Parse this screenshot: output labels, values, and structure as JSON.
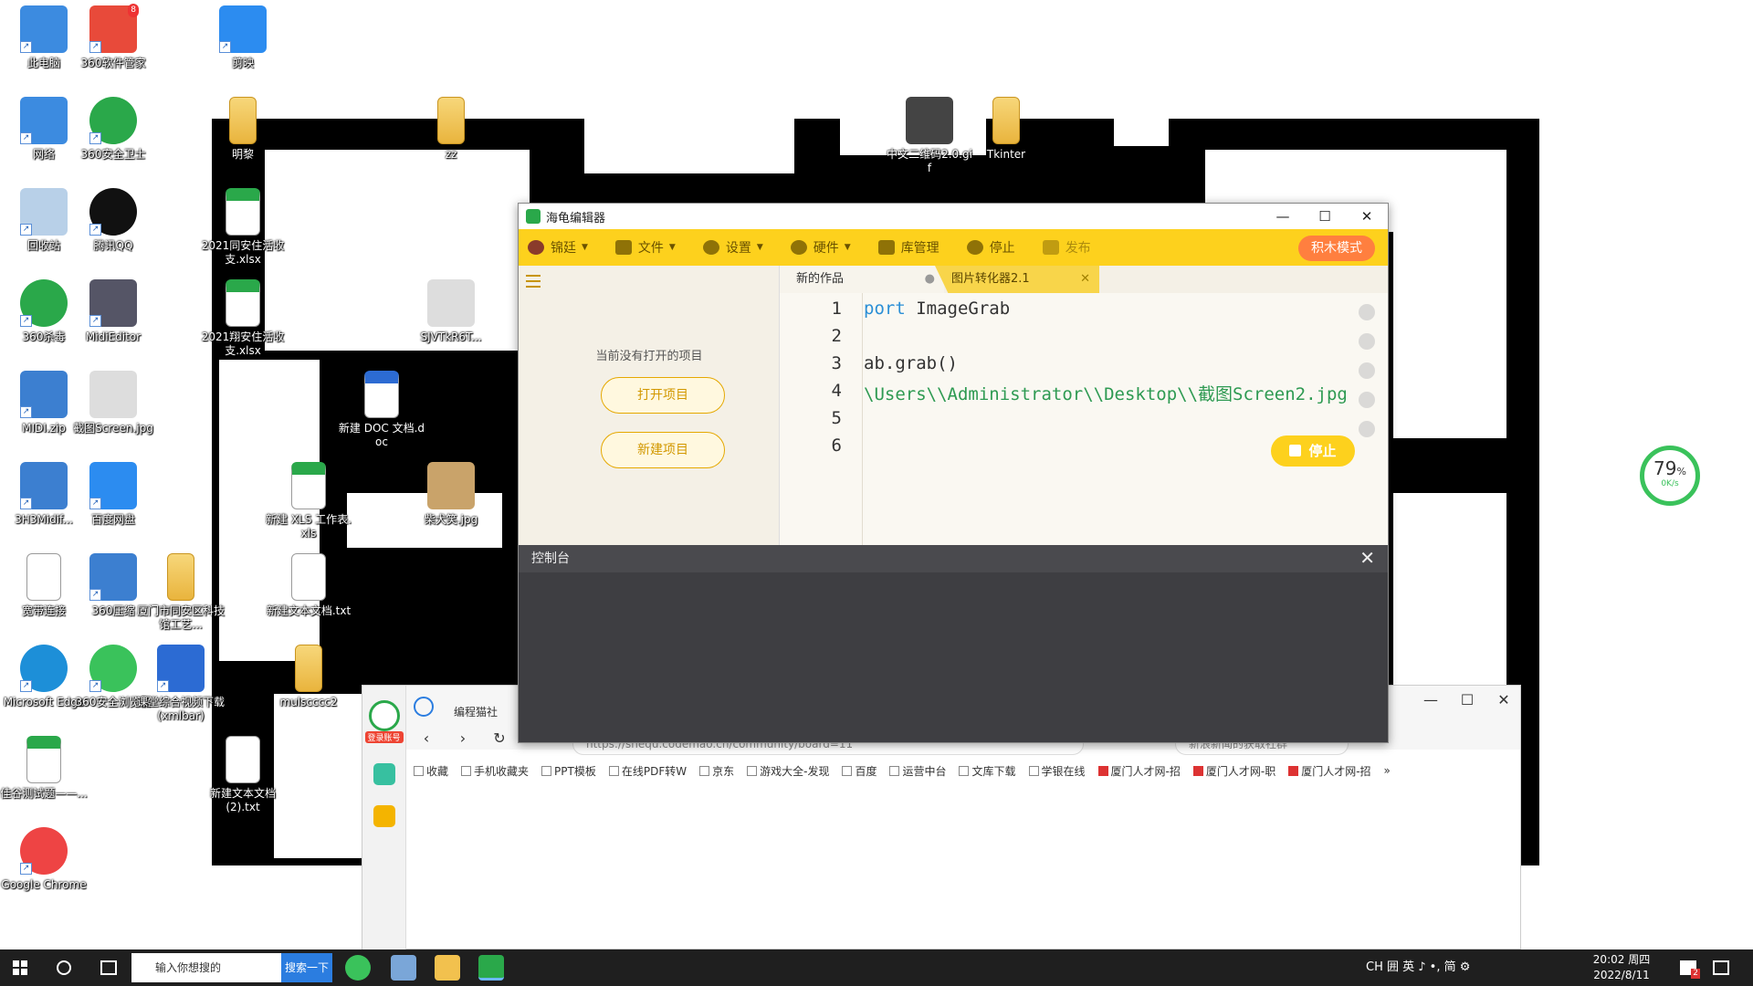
{
  "desktop_icons": [
    {
      "label": "此电脑",
      "kind": "pc"
    },
    {
      "label": "360软件管家",
      "kind": "app360",
      "badge": "8"
    },
    {
      "label": "剪映",
      "kind": "jianying"
    },
    {
      "label": "网络",
      "kind": "network"
    },
    {
      "label": "360安全卫士",
      "kind": "app360s"
    },
    {
      "label": "明黎",
      "kind": "folder"
    },
    {
      "label": "zz",
      "kind": "folder"
    },
    {
      "label": "中文二维码2.0.gif",
      "kind": "qrfile"
    },
    {
      "label": "Tkinter",
      "kind": "folder"
    },
    {
      "label": "回收站",
      "kind": "recycle"
    },
    {
      "label": "腾讯QQ",
      "kind": "qq"
    },
    {
      "label": "2021同安住活收支.xlsx",
      "kind": "xls"
    },
    {
      "label": "360杀毒",
      "kind": "shield"
    },
    {
      "label": "MidiEditor",
      "kind": "midi"
    },
    {
      "label": "2021翔安住活收支.xlsx",
      "kind": "xls"
    },
    {
      "label": "SJVTkR6T...",
      "kind": "img"
    },
    {
      "label": "MIDI.zip",
      "kind": "zip"
    },
    {
      "label": "截图Screen.jpg",
      "kind": "img"
    },
    {
      "label": "新建 DOC 文档.doc",
      "kind": "doc"
    },
    {
      "label": "3H3Midif...",
      "kind": "zip"
    },
    {
      "label": "百度网盘",
      "kind": "baidu"
    },
    {
      "label": "新建 XLS 工作表.xls",
      "kind": "xls"
    },
    {
      "label": "柴犬笑.jpg",
      "kind": "dog"
    },
    {
      "label": "宽带连接",
      "kind": "file"
    },
    {
      "label": "360压缩",
      "kind": "zip"
    },
    {
      "label": "厦门市同安区科技馆工艺...",
      "kind": "folder"
    },
    {
      "label": "新建文本文档.txt",
      "kind": "file"
    },
    {
      "label": "Microsoft Edge",
      "kind": "edge"
    },
    {
      "label": "360安全浏览器",
      "kind": "browser360"
    },
    {
      "label": "课堂综合视频下载(xmlbar)",
      "kind": "mx"
    },
    {
      "label": "mulscccc2",
      "kind": "folder"
    },
    {
      "label": "佳谷测试题——...",
      "kind": "xls"
    },
    {
      "label": "新建文本文档 (2).txt",
      "kind": "file"
    },
    {
      "label": "Google Chrome",
      "kind": "chrome"
    }
  ],
  "editor_window": {
    "title": "海龟编辑器",
    "minimize": "—",
    "maximize": "☐",
    "close": "✕",
    "toolbar": {
      "user": "锦廷",
      "file": "文件",
      "settings": "设置",
      "hardware": "硬件",
      "library": "库管理",
      "stop": "停止",
      "publish": "发布",
      "block_mode": "积木模式"
    },
    "sidebar": {
      "no_project": "当前没有打开的项目",
      "open_project": "打开项目",
      "new_project": "新建项目"
    },
    "tabs": [
      {
        "label": "新的作品",
        "marker": "●"
      },
      {
        "label": "图片转化器2.1",
        "marker": "✕"
      }
    ],
    "code_lines": [
      {
        "n": "1",
        "kw": "port",
        "rest": " ImageGrab",
        "str": ""
      },
      {
        "n": "2",
        "kw": "",
        "rest": "",
        "str": ""
      },
      {
        "n": "3",
        "kw": "",
        "rest": "ab.grab()",
        "str": ""
      },
      {
        "n": "4",
        "kw": "",
        "rest": "",
        "str": "\\Users\\\\Administrator\\\\Desktop\\\\截图Screen2.jpg'"
      },
      {
        "n": "5",
        "kw": "",
        "rest": "",
        "str": ""
      },
      {
        "n": "6",
        "kw": "",
        "rest": "",
        "str": ""
      }
    ],
    "run_stop": "停止",
    "console_title": "控制台",
    "console_close": "✕"
  },
  "browser": {
    "login_label": "登录账号",
    "tab_title": "编程猫社",
    "url": "https://shequ.codemao.cn/community/board=11",
    "search_placeholder": "新浪新闻的获取社群",
    "bookmarks": [
      "收藏",
      "手机收藏夹",
      "PPT模板",
      "在线PDF转W",
      "京东",
      "游戏大全-发现",
      "百度",
      "运营中台",
      "文库下载",
      "学银在线",
      "厦门人才网-招",
      "厦门人才网-职",
      "厦门人才网-招",
      "»"
    ]
  },
  "taskbar": {
    "search_text": "输入你想搜的",
    "search_button": "搜索一下",
    "tray_text": "CH 囲 英 ♪ •, 简 ⚙",
    "time": "20:02 周四",
    "date": "2022/8/11",
    "notif_badge": "2"
  },
  "speed_widget": {
    "percent": "79",
    "unit": "%",
    "rate": "0K/s"
  }
}
